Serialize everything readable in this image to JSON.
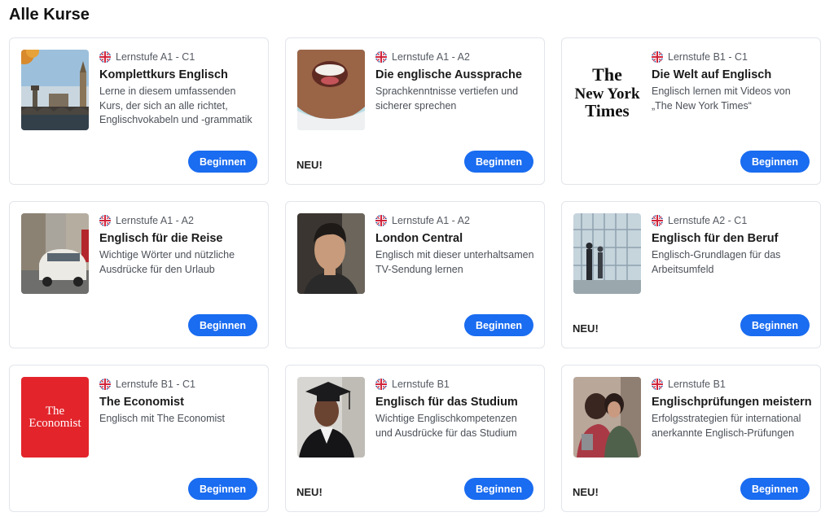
{
  "page": {
    "title": "Alle Kurse"
  },
  "new_label": "NEU!",
  "button_label": "Beginnen",
  "flag_icon": "uk-flag-icon",
  "accent_color": "#1a6cf0",
  "courses": [
    {
      "level": "Lernstufe A1 - C1",
      "title": "Komplettkurs Englisch",
      "description": "Lerne in diesem umfassenden Kurs, der sich an alle richtet, Englischvokabeln und -grammatik",
      "is_new": false,
      "image": "london-bridge-image"
    },
    {
      "level": "Lernstufe A1 - A2",
      "title": "Die englische Aussprache",
      "description": "Sprachkenntnisse vertiefen und sicherer sprechen",
      "is_new": true,
      "image": "smiling-mouth-image"
    },
    {
      "level": "Lernstufe B1 - C1",
      "title": "Die Welt auf Englisch",
      "description": "Englisch lernen mit Videos von „The New York Times“",
      "is_new": false,
      "image": "new-york-times-logo",
      "logo_text": [
        "The",
        "New York",
        "Times"
      ]
    },
    {
      "level": "Lernstufe A1 - A2",
      "title": "Englisch für die Reise",
      "description": "Wichtige Wörter und nützliche Ausdrücke für den Urlaub",
      "is_new": false,
      "image": "london-taxi-image"
    },
    {
      "level": "Lernstufe A1 - A2",
      "title": "London Central",
      "description": "Englisch mit dieser unterhaltsamen TV-Sendung lernen",
      "is_new": false,
      "image": "man-portrait-image"
    },
    {
      "level": "Lernstufe A2 - C1",
      "title": "Englisch für den Beruf",
      "description": "Englisch-Grundlagen für das Arbeitsumfeld",
      "is_new": true,
      "image": "office-building-image"
    },
    {
      "level": "Lernstufe B1 - C1",
      "title": "The Economist",
      "description": "Englisch mit The Economist",
      "is_new": false,
      "image": "economist-logo",
      "logo_text": [
        "The",
        "Economist"
      ]
    },
    {
      "level": "Lernstufe B1",
      "title": "Englisch für das Studium",
      "description": "Wichtige Englischkompetenzen und Ausdrücke für das Studium",
      "is_new": true,
      "image": "graduate-image"
    },
    {
      "level": "Lernstufe B1",
      "title": "Englischprüfungen meistern",
      "description": "Erfolgsstrategien für international anerkannte Englisch-Prüfungen",
      "is_new": true,
      "image": "students-hug-image"
    }
  ]
}
